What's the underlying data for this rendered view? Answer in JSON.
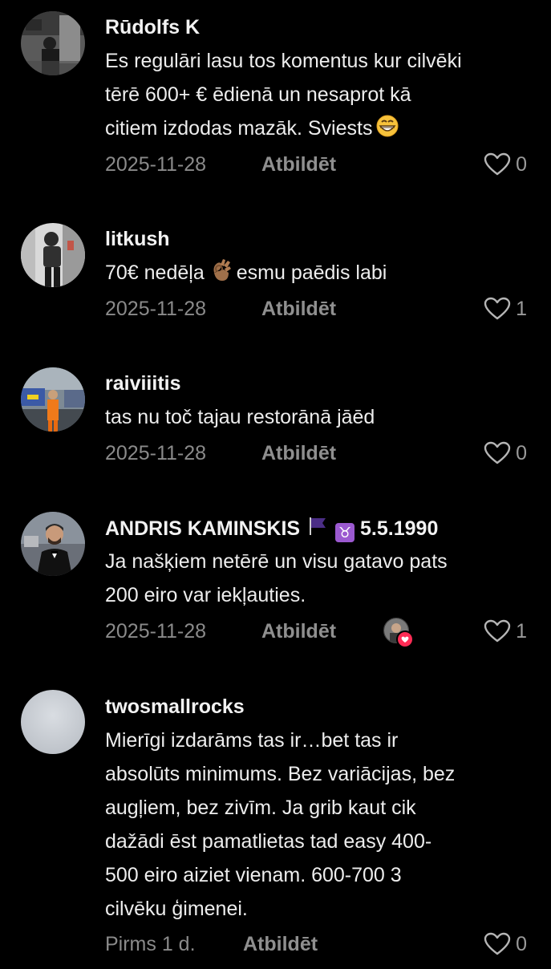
{
  "comments": [
    {
      "username": "Rūdolfs K",
      "text": "Es regulāri lasu tos komentus kur cilvēki\ntērē 600+ € ēdienā un nesaprot kā\ncitiem izdodas mazāk. Sviests",
      "emoji": "grinning-face-emoji",
      "date": "2025-11-28",
      "reply_label": "Atbildēt",
      "likes": "0"
    },
    {
      "username": "litkush",
      "text_before": "70€ nedēļa",
      "emoji": "ok-hand-emoji",
      "text_after": "esmu paēdis labi",
      "date": "2025-11-28",
      "reply_label": "Atbildēt",
      "likes": "1"
    },
    {
      "username": "raiviiitis",
      "text": "tas nu toč tajau restorānā jāēd",
      "date": "2025-11-28",
      "reply_label": "Atbildēt",
      "likes": "0"
    },
    {
      "username": "ANDRIS KAMINSKIS",
      "flag": "purple-flag-emoji",
      "zodiac_symbol": "♉",
      "username_suffix": "5.5.1990",
      "text": "Ja našķiem netērē un visu gatavo pats\n200 eiro var iekļauties.",
      "date": "2025-11-28",
      "reply_label": "Atbildēt",
      "liked_by_creator": true,
      "likes": "1"
    },
    {
      "username": "twosmallrocks",
      "text": "Mierīgi izdarāms tas ir…bet tas ir\nabsolūts minimums. Bez variācijas, bez\naugļiem, bez zivīm. Ja grib kaut cik\ndažādi ēst pamatlietas tad easy 400-\n500 eiro aiziet vienam. 600-700 3\ncilvēku ģimenei.",
      "date": "Pirms 1 d.",
      "reply_label": "Atbildēt",
      "likes": "0"
    }
  ],
  "colors": {
    "background": "#000000",
    "username": "#f2f2f2",
    "text": "#ededed",
    "meta": "#8a8a8a",
    "like_badge": "#fe2c55"
  }
}
